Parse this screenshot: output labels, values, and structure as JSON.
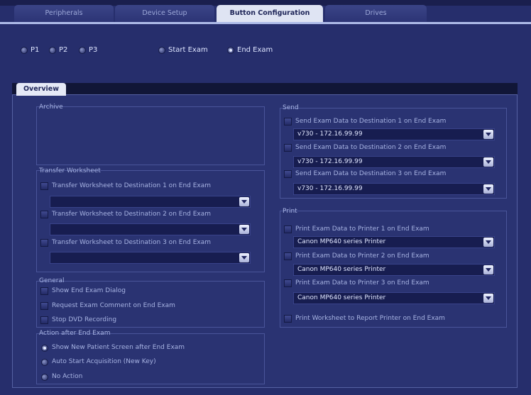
{
  "tabs": [
    "Peripherals",
    "Device Setup",
    "Button Configuration",
    "Drives"
  ],
  "top_radios": {
    "p1": "P1",
    "p2": "P2",
    "p3": "P3",
    "start_exam": "Start Exam",
    "end_exam": "End Exam",
    "selected": "End Exam"
  },
  "overview_tab": "Overview",
  "archive": {
    "title": "Archive"
  },
  "transfer": {
    "title": "Transfer Worksheet",
    "items": [
      "Transfer Worksheet to Destination 1 on End Exam",
      "Transfer Worksheet to Destination 2 on End Exam",
      "Transfer Worksheet to Destination 3 on End Exam"
    ],
    "values": [
      "",
      "",
      ""
    ]
  },
  "general": {
    "title": "General",
    "items": [
      "Show End Exam Dialog",
      "Request Exam Comment on End Exam",
      "Stop DVD Recording"
    ]
  },
  "action": {
    "title": "Action after End Exam",
    "options": [
      "Show New Patient Screen after End Exam",
      "Auto Start Acquisition (New Key)",
      "No Action"
    ],
    "selected": "Show New Patient Screen after End Exam"
  },
  "send": {
    "title": "Send",
    "items": [
      "Send Exam Data to Destination 1 on End Exam",
      "Send Exam Data to Destination 2 on End Exam",
      "Send Exam Data to Destination 3 on End Exam"
    ],
    "values": [
      "v730 - 172.16.99.99",
      "v730 - 172.16.99.99",
      "v730 - 172.16.99.99"
    ]
  },
  "print": {
    "title": "Print",
    "items": [
      "Print Exam Data to Printer 1 on End Exam",
      "Print Exam Data to Printer 2 on End Exam",
      "Print Exam Data to Printer 3 on End Exam"
    ],
    "values": [
      "Canon MP640 series Printer",
      "Canon MP640 series Printer",
      "Canon MP640 series Printer"
    ],
    "worksheet": "Print Worksheet to Report Printer on End Exam"
  },
  "colors": {
    "background": "#262e6c",
    "panel": "#2a3372",
    "active_tab": "#dfe4f3"
  }
}
